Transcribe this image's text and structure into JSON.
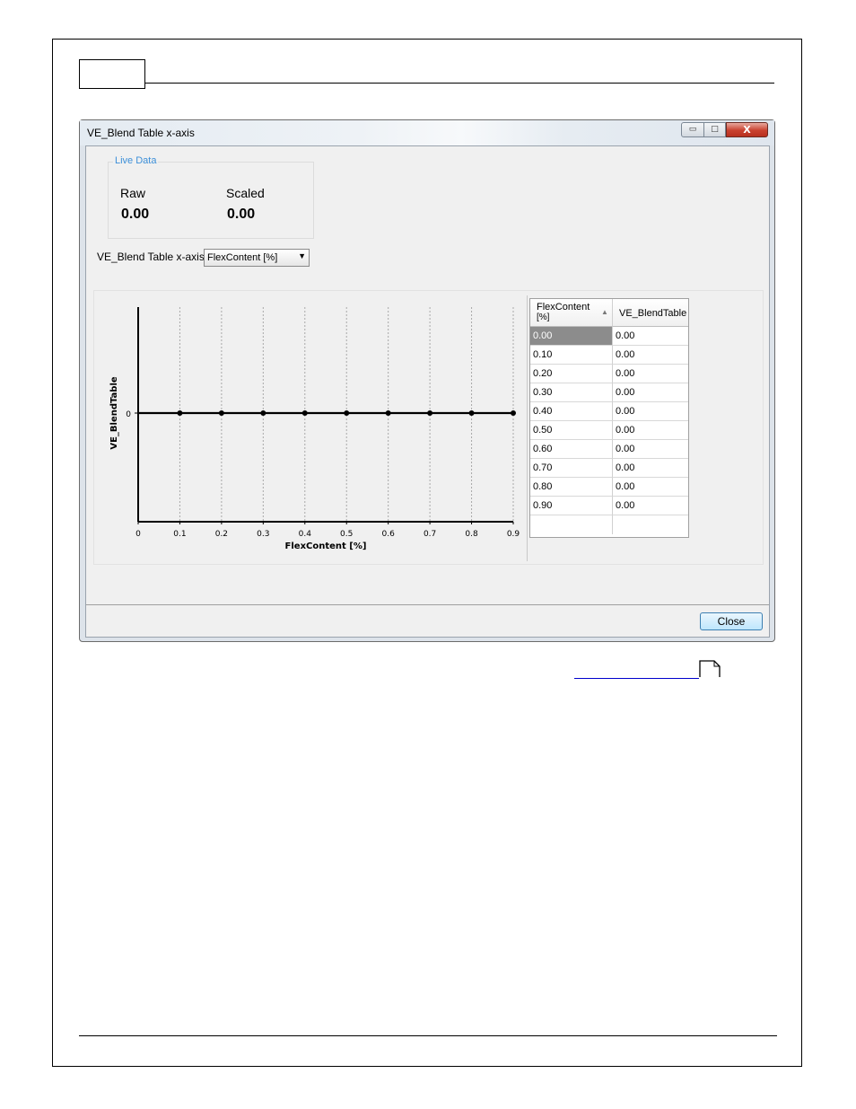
{
  "dialog": {
    "title": "VE_Blend Table x-axis",
    "window_controls": {
      "minimize_icon": "minimize-icon",
      "maximize_icon": "maximize-icon",
      "close_icon": "close-icon",
      "close_glyph": "X"
    },
    "live_data": {
      "legend": "Live Data",
      "raw_label": "Raw",
      "raw_value": "0.00",
      "scaled_label": "Scaled",
      "scaled_value": "0.00"
    },
    "axis_selector": {
      "label": "VE_Blend Table x-axis",
      "selected": "FlexContent [%]"
    },
    "table": {
      "columns": [
        "FlexContent\n[%]",
        "VE_BlendTable"
      ],
      "col1_line1": "FlexContent",
      "col1_line2": "[%]",
      "col2": "VE_BlendTable",
      "rows": [
        [
          "0.00",
          "0.00"
        ],
        [
          "0.10",
          "0.00"
        ],
        [
          "0.20",
          "0.00"
        ],
        [
          "0.30",
          "0.00"
        ],
        [
          "0.40",
          "0.00"
        ],
        [
          "0.50",
          "0.00"
        ],
        [
          "0.60",
          "0.00"
        ],
        [
          "0.70",
          "0.00"
        ],
        [
          "0.80",
          "0.00"
        ],
        [
          "0.90",
          "0.00"
        ]
      ]
    },
    "close_button": "Close"
  },
  "chart_data": {
    "type": "line",
    "x": [
      0,
      0.1,
      0.2,
      0.3,
      0.4,
      0.5,
      0.6,
      0.7,
      0.8,
      0.9
    ],
    "series": [
      {
        "values": [
          0,
          0,
          0,
          0,
          0,
          0,
          0,
          0,
          0,
          0
        ]
      }
    ],
    "xlabel": "FlexContent [%]",
    "ylabel": "VE_BlendTable",
    "x_ticks": [
      "0",
      "0.1",
      "0.2",
      "0.3",
      "0.4",
      "0.5",
      "0.6",
      "0.7",
      "0.8",
      "0.9"
    ],
    "y_ticks": [
      "0"
    ],
    "xlim": [
      0,
      0.9
    ],
    "grid": "vertical dashed",
    "colors": {
      "line": "#000000",
      "grid": "#a8a8a8"
    }
  }
}
